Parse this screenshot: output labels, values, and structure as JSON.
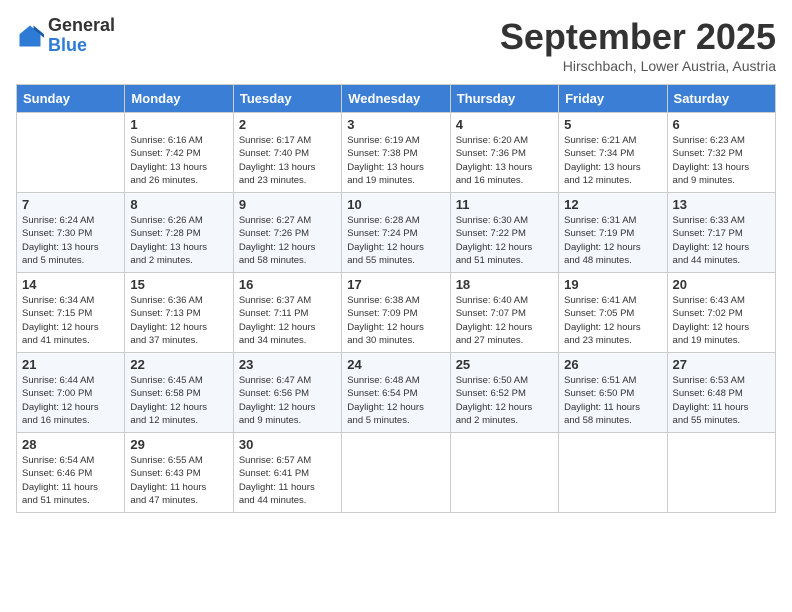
{
  "header": {
    "logo_line1": "General",
    "logo_line2": "Blue",
    "month_title": "September 2025",
    "location": "Hirschbach, Lower Austria, Austria"
  },
  "weekdays": [
    "Sunday",
    "Monday",
    "Tuesday",
    "Wednesday",
    "Thursday",
    "Friday",
    "Saturday"
  ],
  "weeks": [
    [
      {
        "day": "",
        "info": ""
      },
      {
        "day": "1",
        "info": "Sunrise: 6:16 AM\nSunset: 7:42 PM\nDaylight: 13 hours\nand 26 minutes."
      },
      {
        "day": "2",
        "info": "Sunrise: 6:17 AM\nSunset: 7:40 PM\nDaylight: 13 hours\nand 23 minutes."
      },
      {
        "day": "3",
        "info": "Sunrise: 6:19 AM\nSunset: 7:38 PM\nDaylight: 13 hours\nand 19 minutes."
      },
      {
        "day": "4",
        "info": "Sunrise: 6:20 AM\nSunset: 7:36 PM\nDaylight: 13 hours\nand 16 minutes."
      },
      {
        "day": "5",
        "info": "Sunrise: 6:21 AM\nSunset: 7:34 PM\nDaylight: 13 hours\nand 12 minutes."
      },
      {
        "day": "6",
        "info": "Sunrise: 6:23 AM\nSunset: 7:32 PM\nDaylight: 13 hours\nand 9 minutes."
      }
    ],
    [
      {
        "day": "7",
        "info": "Sunrise: 6:24 AM\nSunset: 7:30 PM\nDaylight: 13 hours\nand 5 minutes."
      },
      {
        "day": "8",
        "info": "Sunrise: 6:26 AM\nSunset: 7:28 PM\nDaylight: 13 hours\nand 2 minutes."
      },
      {
        "day": "9",
        "info": "Sunrise: 6:27 AM\nSunset: 7:26 PM\nDaylight: 12 hours\nand 58 minutes."
      },
      {
        "day": "10",
        "info": "Sunrise: 6:28 AM\nSunset: 7:24 PM\nDaylight: 12 hours\nand 55 minutes."
      },
      {
        "day": "11",
        "info": "Sunrise: 6:30 AM\nSunset: 7:22 PM\nDaylight: 12 hours\nand 51 minutes."
      },
      {
        "day": "12",
        "info": "Sunrise: 6:31 AM\nSunset: 7:19 PM\nDaylight: 12 hours\nand 48 minutes."
      },
      {
        "day": "13",
        "info": "Sunrise: 6:33 AM\nSunset: 7:17 PM\nDaylight: 12 hours\nand 44 minutes."
      }
    ],
    [
      {
        "day": "14",
        "info": "Sunrise: 6:34 AM\nSunset: 7:15 PM\nDaylight: 12 hours\nand 41 minutes."
      },
      {
        "day": "15",
        "info": "Sunrise: 6:36 AM\nSunset: 7:13 PM\nDaylight: 12 hours\nand 37 minutes."
      },
      {
        "day": "16",
        "info": "Sunrise: 6:37 AM\nSunset: 7:11 PM\nDaylight: 12 hours\nand 34 minutes."
      },
      {
        "day": "17",
        "info": "Sunrise: 6:38 AM\nSunset: 7:09 PM\nDaylight: 12 hours\nand 30 minutes."
      },
      {
        "day": "18",
        "info": "Sunrise: 6:40 AM\nSunset: 7:07 PM\nDaylight: 12 hours\nand 27 minutes."
      },
      {
        "day": "19",
        "info": "Sunrise: 6:41 AM\nSunset: 7:05 PM\nDaylight: 12 hours\nand 23 minutes."
      },
      {
        "day": "20",
        "info": "Sunrise: 6:43 AM\nSunset: 7:02 PM\nDaylight: 12 hours\nand 19 minutes."
      }
    ],
    [
      {
        "day": "21",
        "info": "Sunrise: 6:44 AM\nSunset: 7:00 PM\nDaylight: 12 hours\nand 16 minutes."
      },
      {
        "day": "22",
        "info": "Sunrise: 6:45 AM\nSunset: 6:58 PM\nDaylight: 12 hours\nand 12 minutes."
      },
      {
        "day": "23",
        "info": "Sunrise: 6:47 AM\nSunset: 6:56 PM\nDaylight: 12 hours\nand 9 minutes."
      },
      {
        "day": "24",
        "info": "Sunrise: 6:48 AM\nSunset: 6:54 PM\nDaylight: 12 hours\nand 5 minutes."
      },
      {
        "day": "25",
        "info": "Sunrise: 6:50 AM\nSunset: 6:52 PM\nDaylight: 12 hours\nand 2 minutes."
      },
      {
        "day": "26",
        "info": "Sunrise: 6:51 AM\nSunset: 6:50 PM\nDaylight: 11 hours\nand 58 minutes."
      },
      {
        "day": "27",
        "info": "Sunrise: 6:53 AM\nSunset: 6:48 PM\nDaylight: 11 hours\nand 55 minutes."
      }
    ],
    [
      {
        "day": "28",
        "info": "Sunrise: 6:54 AM\nSunset: 6:46 PM\nDaylight: 11 hours\nand 51 minutes."
      },
      {
        "day": "29",
        "info": "Sunrise: 6:55 AM\nSunset: 6:43 PM\nDaylight: 11 hours\nand 47 minutes."
      },
      {
        "day": "30",
        "info": "Sunrise: 6:57 AM\nSunset: 6:41 PM\nDaylight: 11 hours\nand 44 minutes."
      },
      {
        "day": "",
        "info": ""
      },
      {
        "day": "",
        "info": ""
      },
      {
        "day": "",
        "info": ""
      },
      {
        "day": "",
        "info": ""
      }
    ]
  ]
}
